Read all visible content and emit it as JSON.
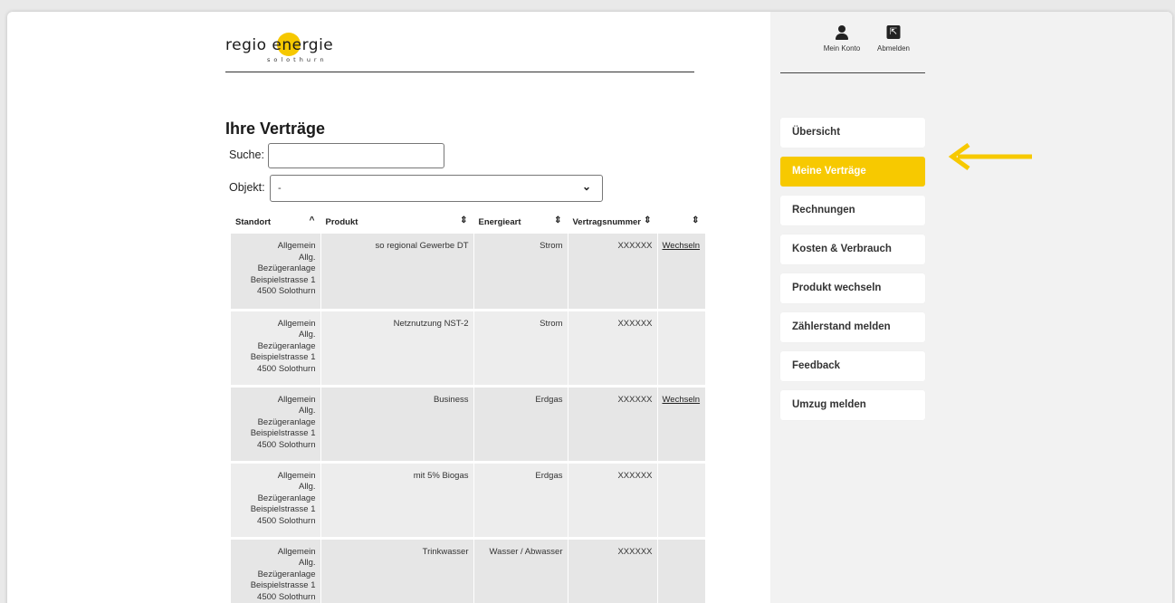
{
  "brand": {
    "name": "regio energie",
    "sub": "solothurn",
    "accent": "#f7c900"
  },
  "page": {
    "title": "Ihre Verträge",
    "search_label": "Suche:",
    "search_value": "",
    "object_label": "Objekt:",
    "object_value": "-"
  },
  "table": {
    "headers": [
      "Standort",
      "Produkt",
      "Energieart",
      "Vertragsnummer",
      ""
    ],
    "rows": [
      {
        "standort": [
          "Allgemein",
          "Allg.",
          "Bezügeranlage",
          "Beispielstrasse 1",
          "4500 Solothurn"
        ],
        "produkt": "so regional Gewerbe DT",
        "energieart": "Strom",
        "vertragsnummer": "XXXXXX",
        "action": "Wechseln"
      },
      {
        "standort": [
          "Allgemein",
          "Allg.",
          "Bezügeranlage",
          "Beispielstrasse 1",
          "4500 Solothurn"
        ],
        "produkt": "Netznutzung NST-2",
        "energieart": "Strom",
        "vertragsnummer": "XXXXXX",
        "action": ""
      },
      {
        "standort": [
          "Allgemein",
          "Allg.",
          "Bezügeranlage",
          "Beispielstrasse 1",
          "4500 Solothurn"
        ],
        "produkt": "Business",
        "energieart": "Erdgas",
        "vertragsnummer": "XXXXXX",
        "action": "Wechseln"
      },
      {
        "standort": [
          "Allgemein",
          "Allg.",
          "Bezügeranlage",
          "Beispielstrasse 1",
          "4500 Solothurn"
        ],
        "produkt": "mit 5% Biogas",
        "energieart": "Erdgas",
        "vertragsnummer": "XXXXXX",
        "action": ""
      },
      {
        "standort": [
          "Allgemein",
          "Allg.",
          "Bezügeranlage",
          "Beispielstrasse 1",
          "4500 Solothurn"
        ],
        "produkt": "Trinkwasser",
        "energieart": "Wasser / Abwasser",
        "vertragsnummer": "XXXXXX",
        "action": ""
      }
    ]
  },
  "account": {
    "konto_label": "Mein Konto",
    "logout_label": "Abmelden"
  },
  "nav": {
    "items": [
      {
        "label": "Übersicht",
        "active": false
      },
      {
        "label": "Meine Verträge",
        "active": true
      },
      {
        "label": "Rechnungen",
        "active": false
      },
      {
        "label": "Kosten & Verbrauch",
        "active": false
      },
      {
        "label": "Produkt wechseln",
        "active": false
      },
      {
        "label": "Zählerstand melden",
        "active": false
      },
      {
        "label": "Feedback",
        "active": false
      },
      {
        "label": "Umzug melden",
        "active": false
      }
    ]
  }
}
